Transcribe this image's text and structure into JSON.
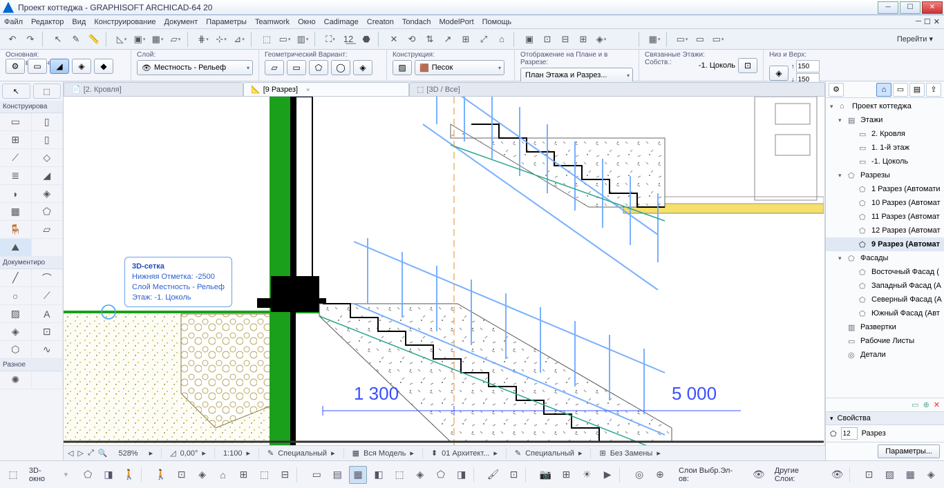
{
  "window": {
    "title": "Проект коттеджа - GRAPHISOFT ARCHICAD-64 20"
  },
  "menu": [
    "Файл",
    "Редактор",
    "Вид",
    "Конструирование",
    "Документ",
    "Параметры",
    "Teamwork",
    "Окно",
    "Cadimage",
    "Creaton",
    "Tondach",
    "ModelPort",
    "Помощь"
  ],
  "goto": "Перейти",
  "opt": {
    "g1_label": "Основная:",
    "sel_label": "Всего выбранных: 1",
    "g2_label": "Слой:",
    "layer_value": "Местность - Рельеф",
    "g3_label": "Геометрический Вариант:",
    "g4_label": "Конструкция:",
    "constr_value": "Песок",
    "g5_label": "Отображение на Плане и в Разрезе:",
    "plan_value": "План Этажа и Разрез...",
    "g6_label": "Связанные Этажи:",
    "own_label": "Собств.:",
    "own_value": "-1. Цоколь",
    "g7_label": "Низ и Верх:",
    "top_val": "150",
    "bot_val": "150"
  },
  "left": {
    "hdr_tools": "Конструирова",
    "hdr_doc": "Документиро",
    "hdr_misc": "Разное"
  },
  "tabs": {
    "t1": "[2. Кровля]",
    "t2": "[9 Разрез]",
    "t3": "[3D / Все]"
  },
  "tooltip": {
    "title": "3D-сетка",
    "l1": "Нижняя Отметка: -2500",
    "l2": "Слой Местность - Рельеф",
    "l3": "Этаж: -1. Цоколь"
  },
  "dims": {
    "d1": "1 300",
    "d2": "5 000"
  },
  "nav": {
    "root": "Проект коттеджа",
    "stories": "Этажи",
    "s1": "2. Кровля",
    "s2": "1. 1-й этаж",
    "s3": "-1. Цоколь",
    "sections": "Разрезы",
    "r1": "1 Разрез (Автомати",
    "r2": "10 Разрез (Автомат",
    "r3": "11 Разрез (Автомат",
    "r4": "12 Разрез (Автомат",
    "r5": "9 Разрез (Автомат",
    "elev": "Фасады",
    "e1": "Восточный Фасад (",
    "e2": "Западный Фасад (А",
    "e3": "Северный Фасад (А",
    "e4": "Южный Фасад (Авт",
    "ie": "Развертки",
    "ws": "Рабочие Листы",
    "det": "Детали"
  },
  "props": {
    "header": "Свойства",
    "id": "12",
    "type": "Разрез",
    "btn": "Параметры..."
  },
  "status": {
    "zoom": "528%",
    "angle": "0,00°",
    "scale": "1:100",
    "s1": "Специальный",
    "s2": "Вся Модель",
    "s3": "01 Архитект...",
    "s4": "Специальный",
    "s5": "Без Замены"
  },
  "bottom": {
    "btn3d": "3D-окно",
    "lay1": "Слои Выбр.Эл-ов:",
    "lay2": "Другие Слои:"
  }
}
